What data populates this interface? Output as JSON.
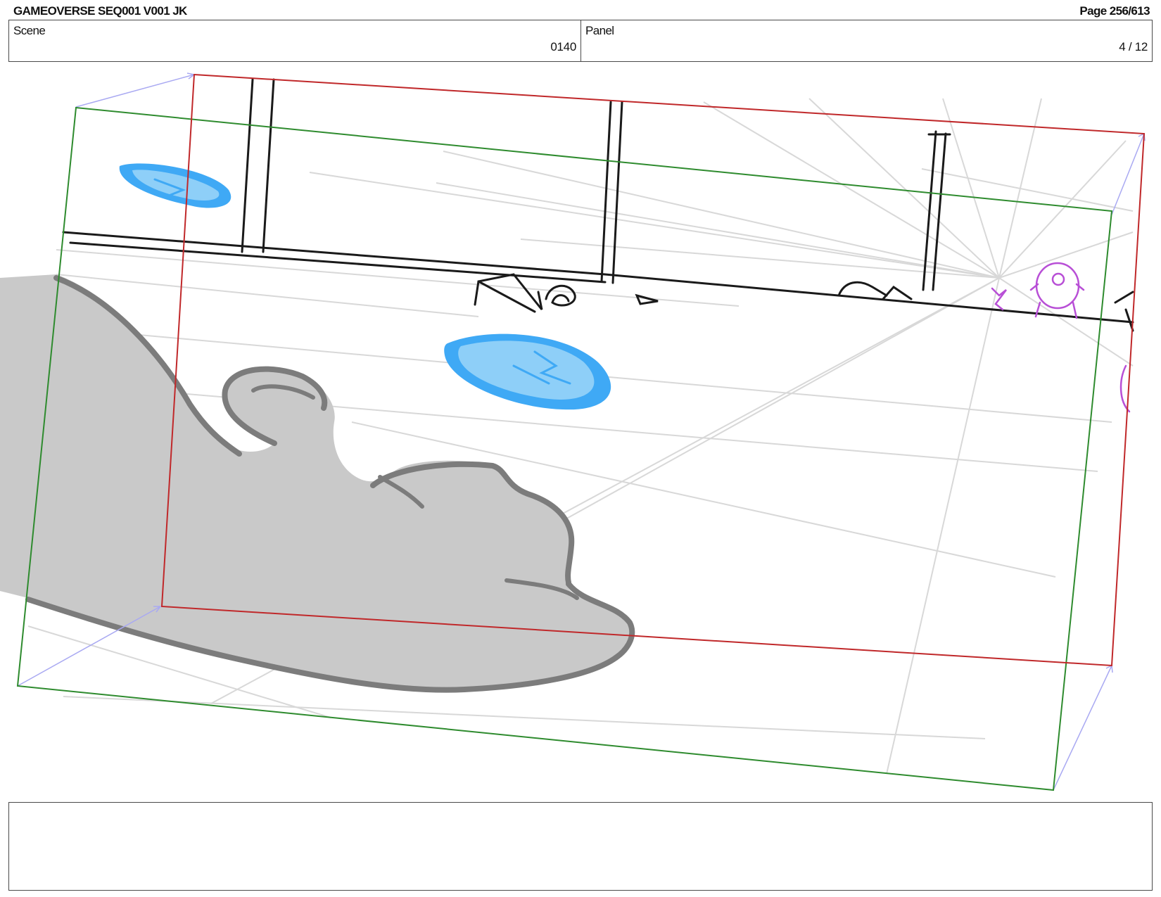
{
  "header": {
    "title": "GAMEOVERSE SEQ001 V001 JK",
    "page": "Page 256/613"
  },
  "info": {
    "scene_label": "Scene",
    "scene_value": "0140",
    "panel_label": "Panel",
    "panel_value": "4 / 12"
  },
  "notes": {
    "text": ""
  },
  "colors": {
    "camera_frame_start": "#2e8b2e",
    "camera_frame_end": "#c0282a",
    "camera_path": "#a9a9f2",
    "perspective_guides": "#d6d6d6",
    "blue_blob": "#3fa9f5",
    "blue_blob_highlight": "#8ecff8",
    "foreground_shape_fill": "#c9c9c9",
    "foreground_shape_outline": "#7c7c7c",
    "character_sketch": "#b84fd6"
  }
}
